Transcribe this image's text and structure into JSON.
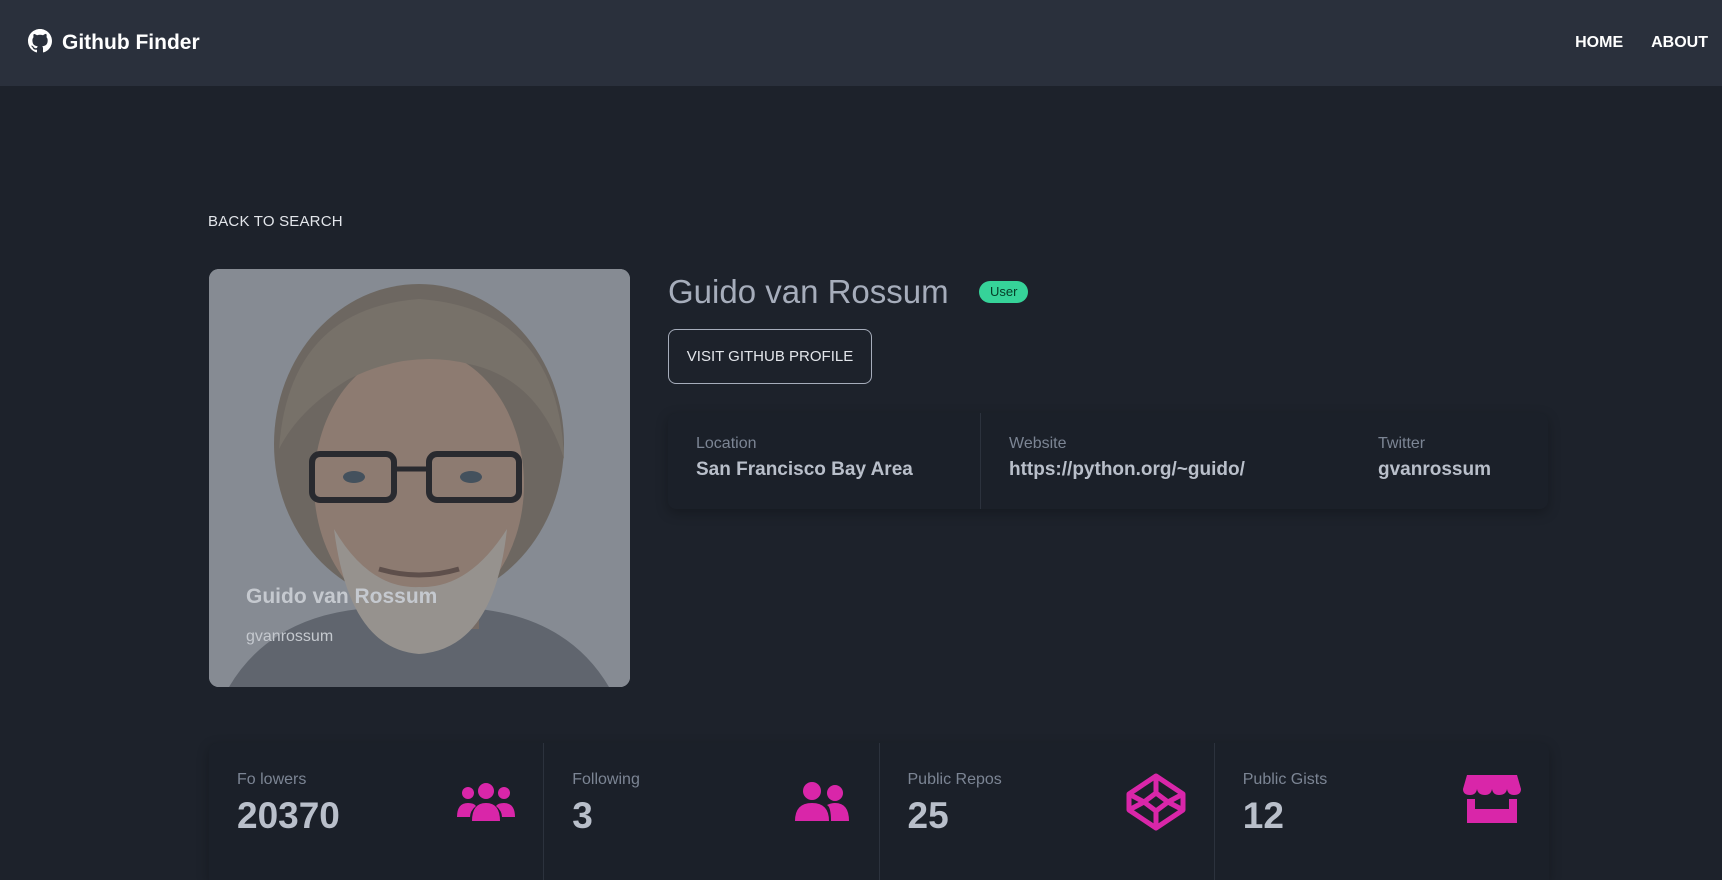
{
  "navbar": {
    "brand": "Github Finder",
    "brand_icon": "github-icon",
    "links": [
      "HOME",
      "ABOUT"
    ]
  },
  "back_label": "BACK TO SEARCH",
  "profile": {
    "name": "Guido van Rossum",
    "login": "gvanrossum",
    "type": "User",
    "visit_label": "VISIT GITHUB PROFILE"
  },
  "info": [
    {
      "label": "Location",
      "value": "San Francisco Bay Area"
    },
    {
      "label": "Website",
      "value": "https://python.org/~guido/"
    },
    {
      "label": "Twitter",
      "value": "gvanrossum"
    }
  ],
  "stats": [
    {
      "label": "Fo lowers",
      "value": "20370",
      "icon": "users-icon"
    },
    {
      "label": "Following",
      "value": "3",
      "icon": "user-friends-icon"
    },
    {
      "label": "Public Repos",
      "value": "25",
      "icon": "codepen-icon"
    },
    {
      "label": "Public Gists",
      "value": "12",
      "icon": "store-icon"
    }
  ],
  "colors": {
    "background": "#1d222b",
    "navbar": "#2a303c",
    "accent_icon": "#d926a9",
    "badge": "#36d399"
  }
}
